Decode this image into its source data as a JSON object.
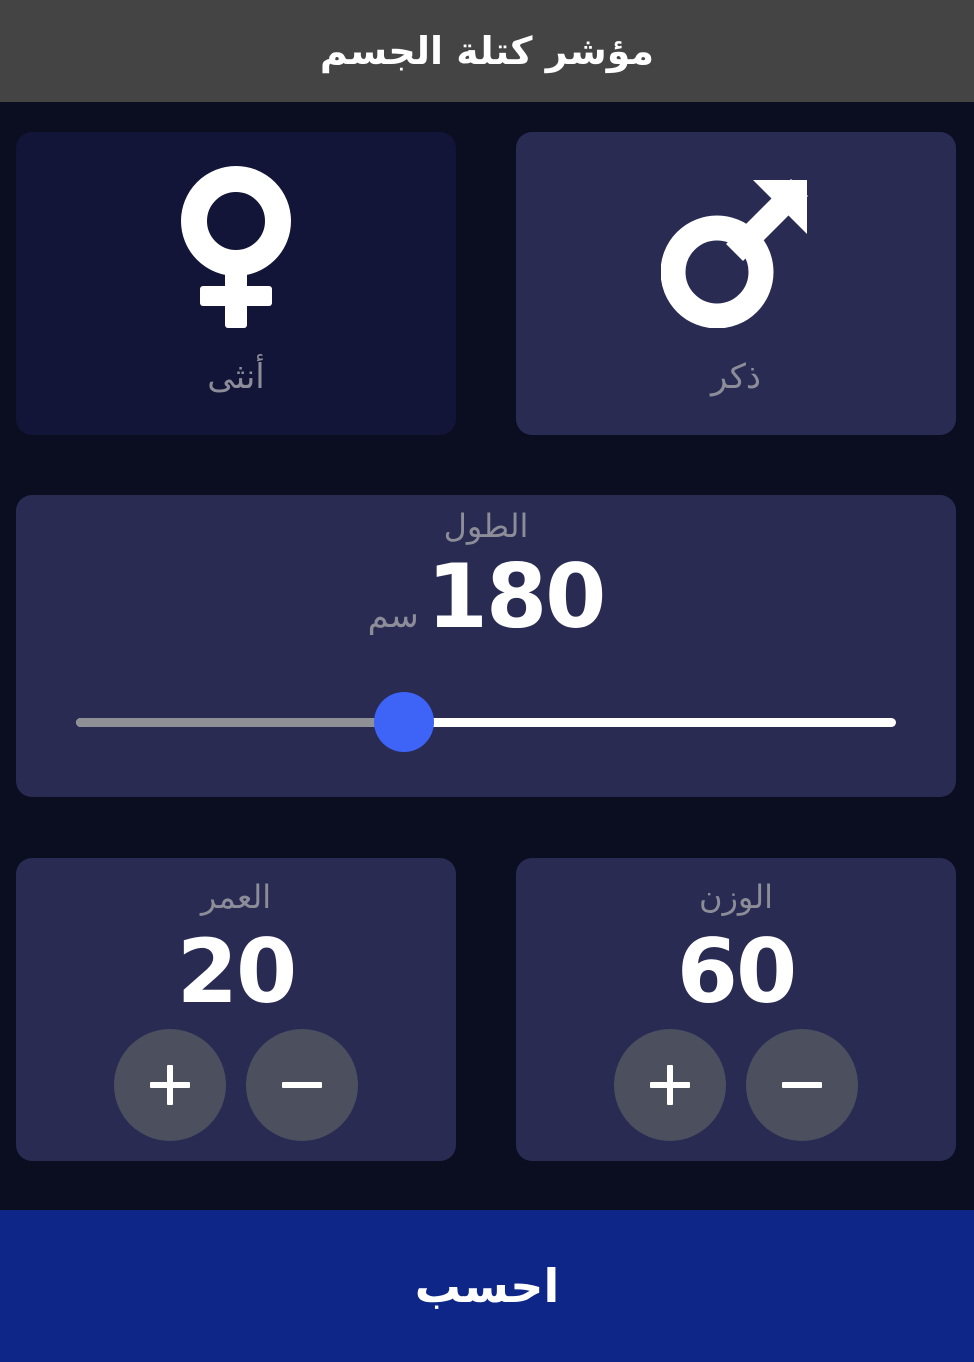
{
  "appbar": {
    "title": "مؤشر كتلة الجسم"
  },
  "gender": {
    "female": {
      "label": "أنثى",
      "icon": "female-symbol-icon",
      "selected": false
    },
    "male": {
      "label": "ذكر",
      "icon": "male-symbol-icon",
      "selected": true
    }
  },
  "height": {
    "label": "الطول",
    "value": "180",
    "unit": "سم",
    "slider_fraction": 0.4
  },
  "weight": {
    "label": "الوزن",
    "value": "60",
    "plus_icon": "plus-icon",
    "minus_icon": "minus-icon"
  },
  "age": {
    "label": "العمر",
    "value": "20",
    "plus_icon": "plus-icon",
    "minus_icon": "minus-icon"
  },
  "calculate": {
    "label": "احسب"
  },
  "colors": {
    "background": "#0b0e21",
    "card_active": "#292b52",
    "card_inactive": "#121438",
    "accent": "#3d63f7",
    "button": "#0d2688",
    "appbar": "#444444"
  }
}
